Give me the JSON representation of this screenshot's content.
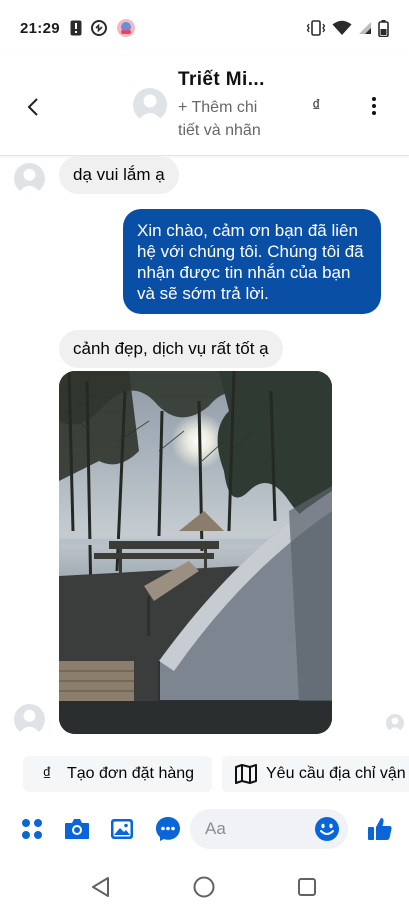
{
  "status_bar": {
    "time": "21:29"
  },
  "header": {
    "contact_name": "Triết Mi...",
    "subtitle": "+ Thêm chi tiết và nhãn",
    "currency_symbol": "₫"
  },
  "messages": [
    {
      "direction": "incoming",
      "text": "dạ vui lắm ạ"
    },
    {
      "direction": "outgoing",
      "text": "Xin chào, cảm ơn bạn đã liên hệ với chúng tôi. Chúng tôi đã nhận được tin nhắn của bạn và sẽ sớm trả lời."
    },
    {
      "direction": "incoming",
      "text": "cảnh đẹp, dịch vụ rất tốt ạ"
    },
    {
      "direction": "incoming",
      "type": "photo"
    }
  ],
  "quick_replies": [
    {
      "label": "Tạo đơn đặt hàng",
      "icon": "dong-icon",
      "icon_text": "₫"
    },
    {
      "label": "Yêu cầu địa chỉ vận chuyển",
      "icon": "map-icon"
    }
  ],
  "composer": {
    "placeholder": "Aa",
    "icons": [
      "menu-grid-icon",
      "camera-icon",
      "gallery-icon",
      "chat-bubble-icon",
      "emoji-icon",
      "like-icon"
    ]
  },
  "colors": {
    "accent": "#0a66d8",
    "outgoing_bubble": "#0a4fa6",
    "incoming_bubble": "#f0f0f0"
  }
}
